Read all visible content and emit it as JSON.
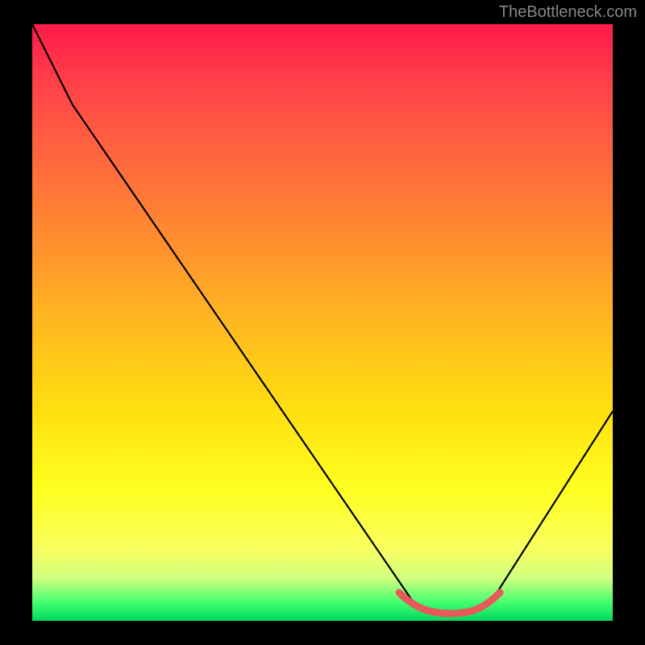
{
  "watermark": "TheBottleneck.com",
  "chart_data": {
    "type": "line",
    "title": "",
    "xlabel": "",
    "ylabel": "",
    "x_range": [
      0,
      100
    ],
    "y_range": [
      0,
      100
    ],
    "series": [
      {
        "name": "bottleneck-curve",
        "x": [
          0,
          6,
          12,
          20,
          30,
          40,
          50,
          58,
          64,
          68,
          72,
          76,
          80,
          86,
          92,
          100
        ],
        "y": [
          100,
          92,
          86,
          76,
          63,
          50,
          36,
          24,
          14,
          7,
          2,
          1,
          2,
          8,
          18,
          35
        ]
      },
      {
        "name": "highlight-optimal-zone",
        "x": [
          64,
          68,
          72,
          76,
          80
        ],
        "y": [
          3,
          1.5,
          1,
          1.5,
          3
        ]
      }
    ],
    "background_gradient": {
      "top": "#ff1a4a",
      "mid_upper": "#ff8a30",
      "mid": "#ffe010",
      "mid_lower": "#ffff20",
      "bottom": "#00d860"
    }
  }
}
